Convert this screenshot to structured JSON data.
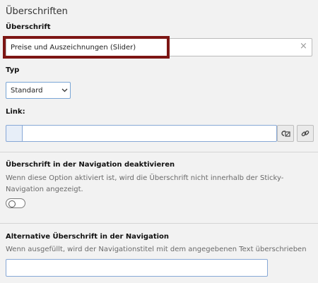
{
  "section": {
    "title": "Überschriften"
  },
  "heading_field": {
    "label": "Überschrift",
    "value": "Preise und Auszeichnungen (Slider)",
    "clear_icon": "×"
  },
  "type_field": {
    "label": "Typ",
    "selected": "Standard"
  },
  "link_field": {
    "label": "Link:",
    "value": ""
  },
  "nav_disable": {
    "label": "Überschrift in der Navigation deaktivieren",
    "help": "Wenn diese Option aktiviert ist, wird die Überschrift nicht innerhalb der Sticky-Navigation angezeigt.",
    "checked": false
  },
  "alt_heading": {
    "label": "Alternative Überschrift in der Navigation",
    "help": "Wenn ausgefüllt, wird der Navigationstitel mit dem angegebenen Text überschrieben",
    "value": ""
  },
  "icons": {
    "clear": "close-icon",
    "chevron": "chevron-down-icon",
    "link_browser": "link-browser-icon",
    "link": "link-icon"
  },
  "colors": {
    "highlight": "#7d1614",
    "focus_border": "#7aa6d6",
    "background": "#f2f2f2"
  }
}
